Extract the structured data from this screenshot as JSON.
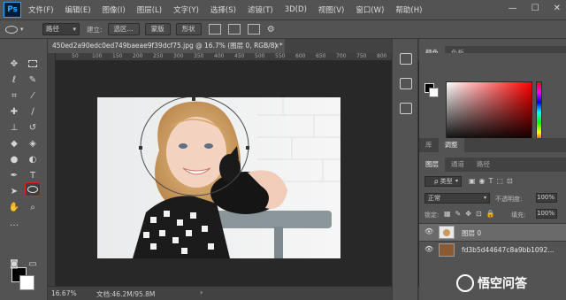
{
  "app": {
    "logo": "Ps",
    "menu": [
      "文件(F)",
      "编辑(E)",
      "图像(I)",
      "图层(L)",
      "文字(Y)",
      "选择(S)",
      "滤镜(T)",
      "3D(D)",
      "视图(V)",
      "窗口(W)",
      "帮助(H)"
    ],
    "window_controls": [
      "—",
      "☐",
      "✕"
    ]
  },
  "options": {
    "mode": "路径",
    "make_label": "建立:",
    "selection_btn": "选区...",
    "mask_btn": "蒙版",
    "shape_btn": "形状",
    "gear": "⚙"
  },
  "document": {
    "tab_title": "450ed2a90edc0ed749baeae9f39dcf75.jpg @ 16.7% (图层 0, RGB/8) *",
    "tab_close": "×",
    "ruler_ticks": [
      "50",
      "100",
      "150",
      "200",
      "250",
      "300",
      "350",
      "400",
      "450",
      "500",
      "550",
      "600",
      "650",
      "700",
      "750",
      "800",
      "850"
    ],
    "status_zoom": "16.67%",
    "status_doc": "文档:46.2M/95.8M",
    "status_arrow": "›"
  },
  "panels": {
    "color_tabs": [
      "颜色",
      "色板"
    ],
    "adjust_tabs": [
      "库",
      "调整"
    ],
    "layers_tabs": [
      "图层",
      "通道",
      "路径"
    ],
    "filter_label": "ρ 类型",
    "blend_mode": "正常",
    "opacity_label": "不透明度:",
    "opacity_value": "100%",
    "lock_label": "锁定:",
    "fill_label": "填充:",
    "fill_value": "100%",
    "layers": [
      {
        "name": "图层 0",
        "selected": true
      },
      {
        "name": "fd3b5d44647c8a9bb1092..."
      }
    ],
    "eye": "👁"
  },
  "watermark": {
    "text": "悟空问答"
  },
  "icons": {
    "move": "move-icon",
    "marquee": "rect-marquee-icon",
    "lasso": "lasso-icon",
    "ellipse": "ellipse-tool-icon"
  }
}
